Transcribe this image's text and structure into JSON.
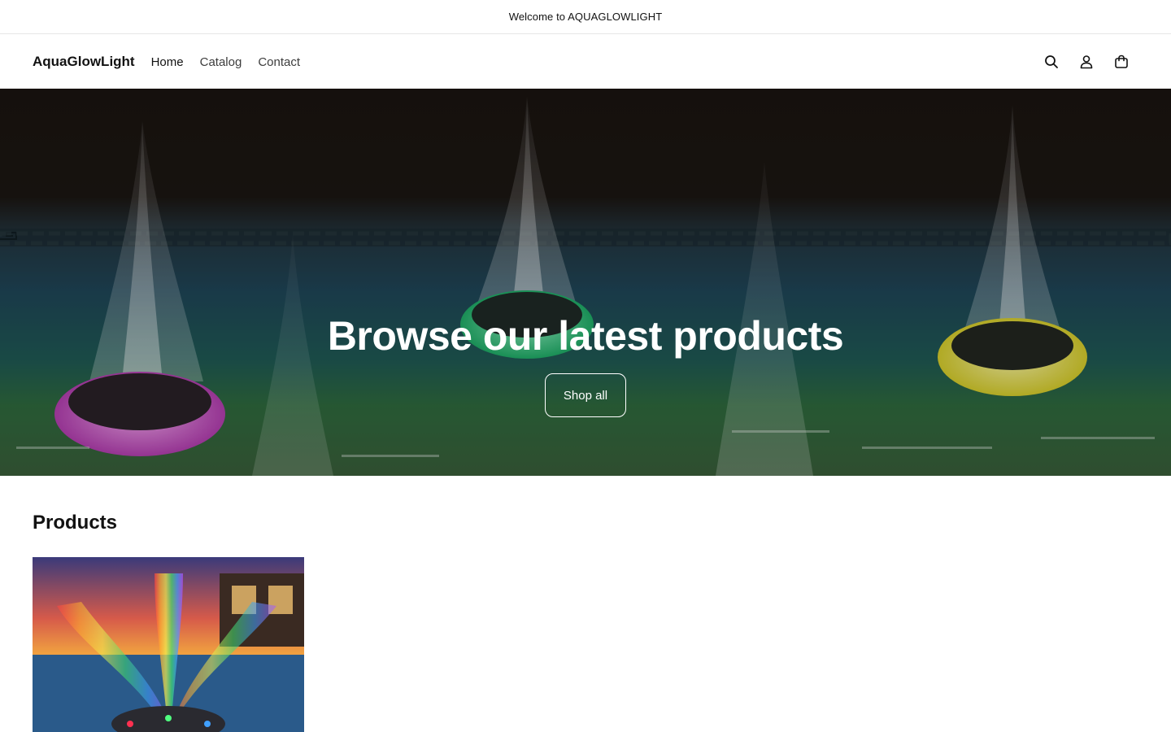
{
  "announcement": {
    "text": "Welcome to AQUAGLOWLIGHT"
  },
  "header": {
    "logo": "AquaGlowLight",
    "nav": [
      {
        "label": "Home",
        "active": true
      },
      {
        "label": "Catalog",
        "active": false
      },
      {
        "label": "Contact",
        "active": false
      }
    ],
    "icons": [
      "search-icon",
      "account-icon",
      "cart-icon"
    ]
  },
  "hero": {
    "title": "Browse our latest products",
    "button_label": "Shop all"
  },
  "products": {
    "heading": "Products"
  },
  "colors": {
    "text": "#121212",
    "border": "#e6e6e6",
    "fountain_pink": "#d84fd0",
    "fountain_green": "#2fd07a",
    "fountain_yellow": "#e8e04a"
  }
}
